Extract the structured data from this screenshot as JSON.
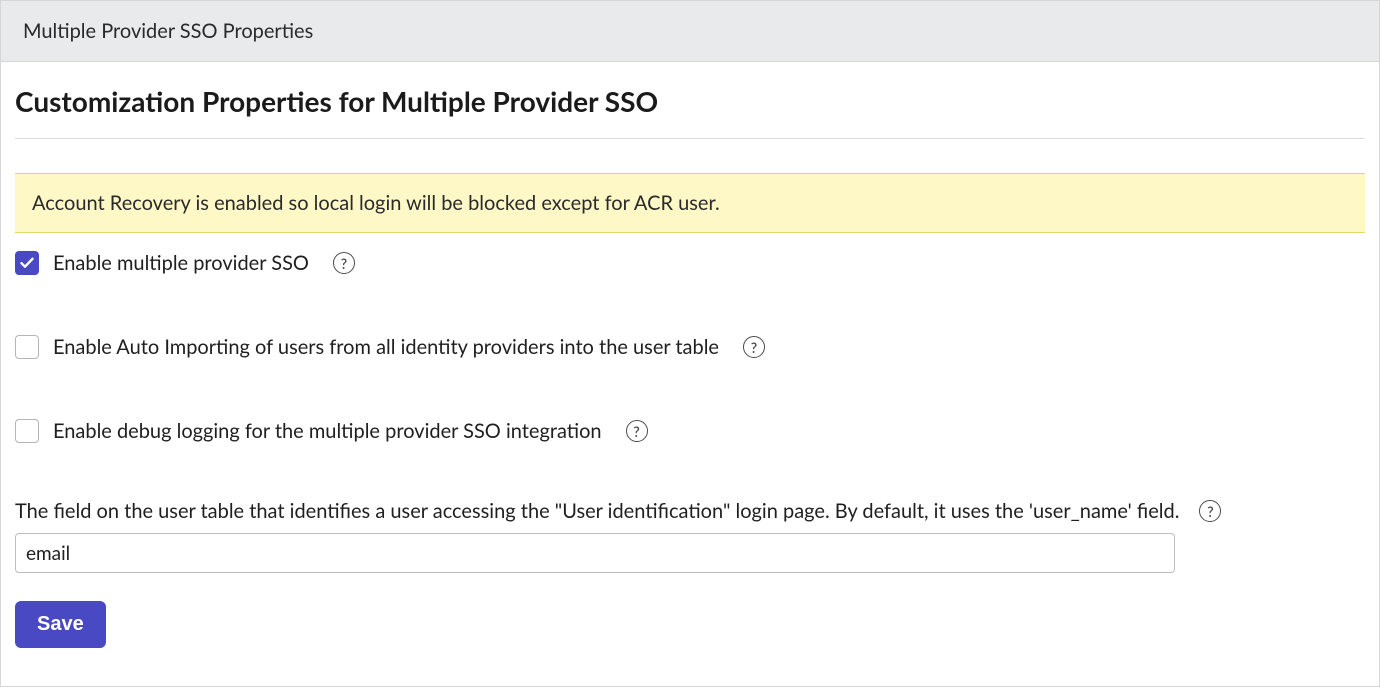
{
  "header": {
    "title": "Multiple Provider SSO Properties"
  },
  "page": {
    "title": "Customization Properties for Multiple Provider SSO"
  },
  "notice": {
    "text": "Account Recovery is enabled so local login will be blocked except for ACR user."
  },
  "fields": {
    "enable_sso": {
      "label": "Enable multiple provider SSO",
      "checked": true
    },
    "auto_import": {
      "label": "Enable Auto Importing of users from all identity providers into the user table",
      "checked": false
    },
    "debug_logging": {
      "label": "Enable debug logging for the multiple provider SSO integration",
      "checked": false
    },
    "user_identifier": {
      "label": "The field on the user table that identifies a user accessing the \"User identification\" login page. By default, it uses the 'user_name' field.",
      "value": "email"
    }
  },
  "buttons": {
    "save": "Save"
  },
  "icons": {
    "help_glyph": "?"
  }
}
